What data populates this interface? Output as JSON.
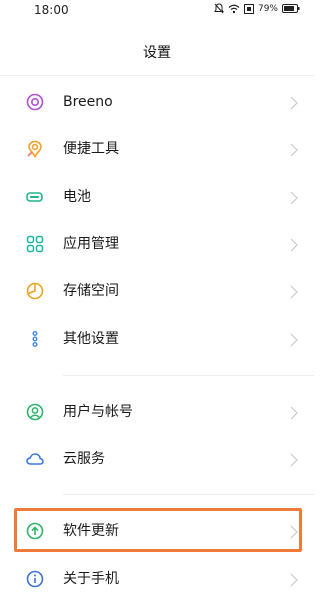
{
  "status_bar": {
    "time": "18:00",
    "battery_percent": "79%"
  },
  "header": {
    "title": "设置"
  },
  "items": [
    {
      "label": "Breeno",
      "icon": "breeno-icon",
      "color": "#b04fd1"
    },
    {
      "label": "便捷工具",
      "icon": "convenience-tools-icon",
      "color": "#f1a02a"
    },
    {
      "label": "电池",
      "icon": "battery-icon",
      "color": "#21b38a"
    },
    {
      "label": "应用管理",
      "icon": "app-management-icon",
      "color": "#1fb3a6"
    },
    {
      "label": "存储空间",
      "icon": "storage-icon",
      "color": "#f0a424"
    },
    {
      "label": "其他设置",
      "icon": "other-settings-icon",
      "color": "#3f86e6"
    },
    {
      "label": "用户与帐号",
      "icon": "user-account-icon",
      "color": "#2db36b"
    },
    {
      "label": "云服务",
      "icon": "cloud-service-icon",
      "color": "#3a78e0"
    },
    {
      "label": "软件更新",
      "icon": "software-update-icon",
      "color": "#2db36b"
    },
    {
      "label": "关于手机",
      "icon": "about-phone-icon",
      "color": "#3f6fd8"
    }
  ],
  "highlight": {
    "color": "#f07a3a",
    "target": "软件更新"
  }
}
